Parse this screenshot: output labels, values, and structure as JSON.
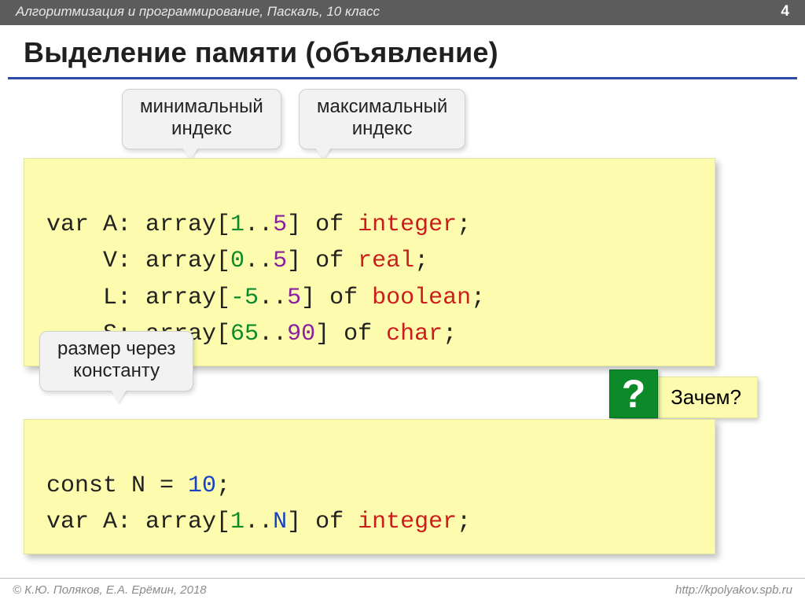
{
  "header": {
    "course": "Алгоритмизация и программирование, Паскаль, 10 класс",
    "page": "4"
  },
  "title": "Выделение памяти (объявление)",
  "callouts": {
    "min_index": "минимальный\nиндекс",
    "max_index": "максимальный\nиндекс",
    "size_const": "размер через\nконстанту"
  },
  "code1": {
    "l1": {
      "pre": "var A: array[",
      "a": "1",
      "mid": "..",
      "b": "5",
      "post": "] of ",
      "type": "integer",
      "end": ";"
    },
    "l2": {
      "pre": "    V: array[",
      "a": "0",
      "mid": "..",
      "b": "5",
      "post": "] of ",
      "type": "real",
      "end": ";"
    },
    "l3": {
      "pre": "    L: array[",
      "a": "-5",
      "mid": "..",
      "b": "5",
      "post": "] of ",
      "type": "boolean",
      "end": ";"
    },
    "l4": {
      "pre": "    S: array[",
      "a": "65",
      "mid": "..",
      "b": "90",
      "post": "] of ",
      "type": "char",
      "end": ";"
    }
  },
  "code2": {
    "l1": {
      "pre": "const N = ",
      "n": "10",
      "end": ";"
    },
    "l2": {
      "pre": "var A: array[",
      "a": "1",
      "mid": "..",
      "b": "N",
      "post": "] of ",
      "type": "integer",
      "end": ";"
    }
  },
  "question": {
    "mark": "?",
    "text": "Зачем?"
  },
  "footer": {
    "left": "© К.Ю. Поляков, Е.А. Ерёмин, 2018",
    "right": "http://kpolyakov.spb.ru"
  }
}
